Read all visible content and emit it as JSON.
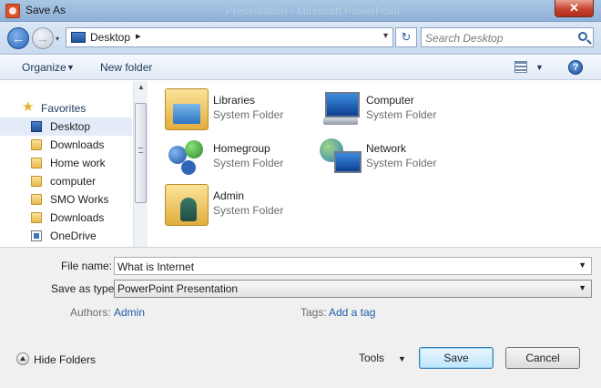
{
  "window": {
    "title": "Save As",
    "ghost_title": "Presentation - Microsoft PowerPoint",
    "close_glyph": "✕"
  },
  "address": {
    "current": "Desktop",
    "search_placeholder": "Search Desktop",
    "path_arrow": "▸",
    "drop_glyph": "▾",
    "refresh_glyph": "↻"
  },
  "toolbar": {
    "organize": "Organize",
    "new_folder": "New folder",
    "caret": "▼",
    "help": "?"
  },
  "nav": {
    "favorites_label": "Favorites",
    "items": [
      {
        "label": "Desktop",
        "icon": "desktop-icon",
        "selected": true
      },
      {
        "label": "Downloads",
        "icon": "folder-icon"
      },
      {
        "label": "Home work",
        "icon": "folder-icon"
      },
      {
        "label": "computer",
        "icon": "folder-icon"
      },
      {
        "label": "SMO Works",
        "icon": "folder-icon"
      },
      {
        "label": "Downloads",
        "icon": "folder-icon"
      },
      {
        "label": "OneDrive",
        "icon": "onedrive-icon"
      }
    ],
    "scroll_up_glyph": "▲"
  },
  "content": {
    "items": [
      {
        "name": "Libraries",
        "type": "System Folder",
        "icon": "libraries-icon"
      },
      {
        "name": "Computer",
        "type": "System Folder",
        "icon": "computer-icon"
      },
      {
        "name": "Homegroup",
        "type": "System Folder",
        "icon": "homegroup-icon"
      },
      {
        "name": "Network",
        "type": "System Folder",
        "icon": "network-icon"
      },
      {
        "name": "Admin",
        "type": "System Folder",
        "icon": "admin-user-icon"
      }
    ]
  },
  "form": {
    "filename_label": "File name:",
    "filename_value": "What is Internet",
    "type_label": "Save as type:",
    "type_value": "PowerPoint Presentation",
    "authors_label": "Authors:",
    "authors_value": "Admin",
    "tags_label": "Tags:",
    "tags_value": "Add a tag",
    "caret": "▼"
  },
  "footer": {
    "hide_folders": "Hide Folders",
    "tools": "Tools",
    "save": "Save",
    "cancel": "Cancel"
  },
  "colors": {
    "titlebar": "#a9c6e4",
    "close_button": "#c7442f",
    "link": "#1f5ea8",
    "selection": "#e3ecf8"
  }
}
